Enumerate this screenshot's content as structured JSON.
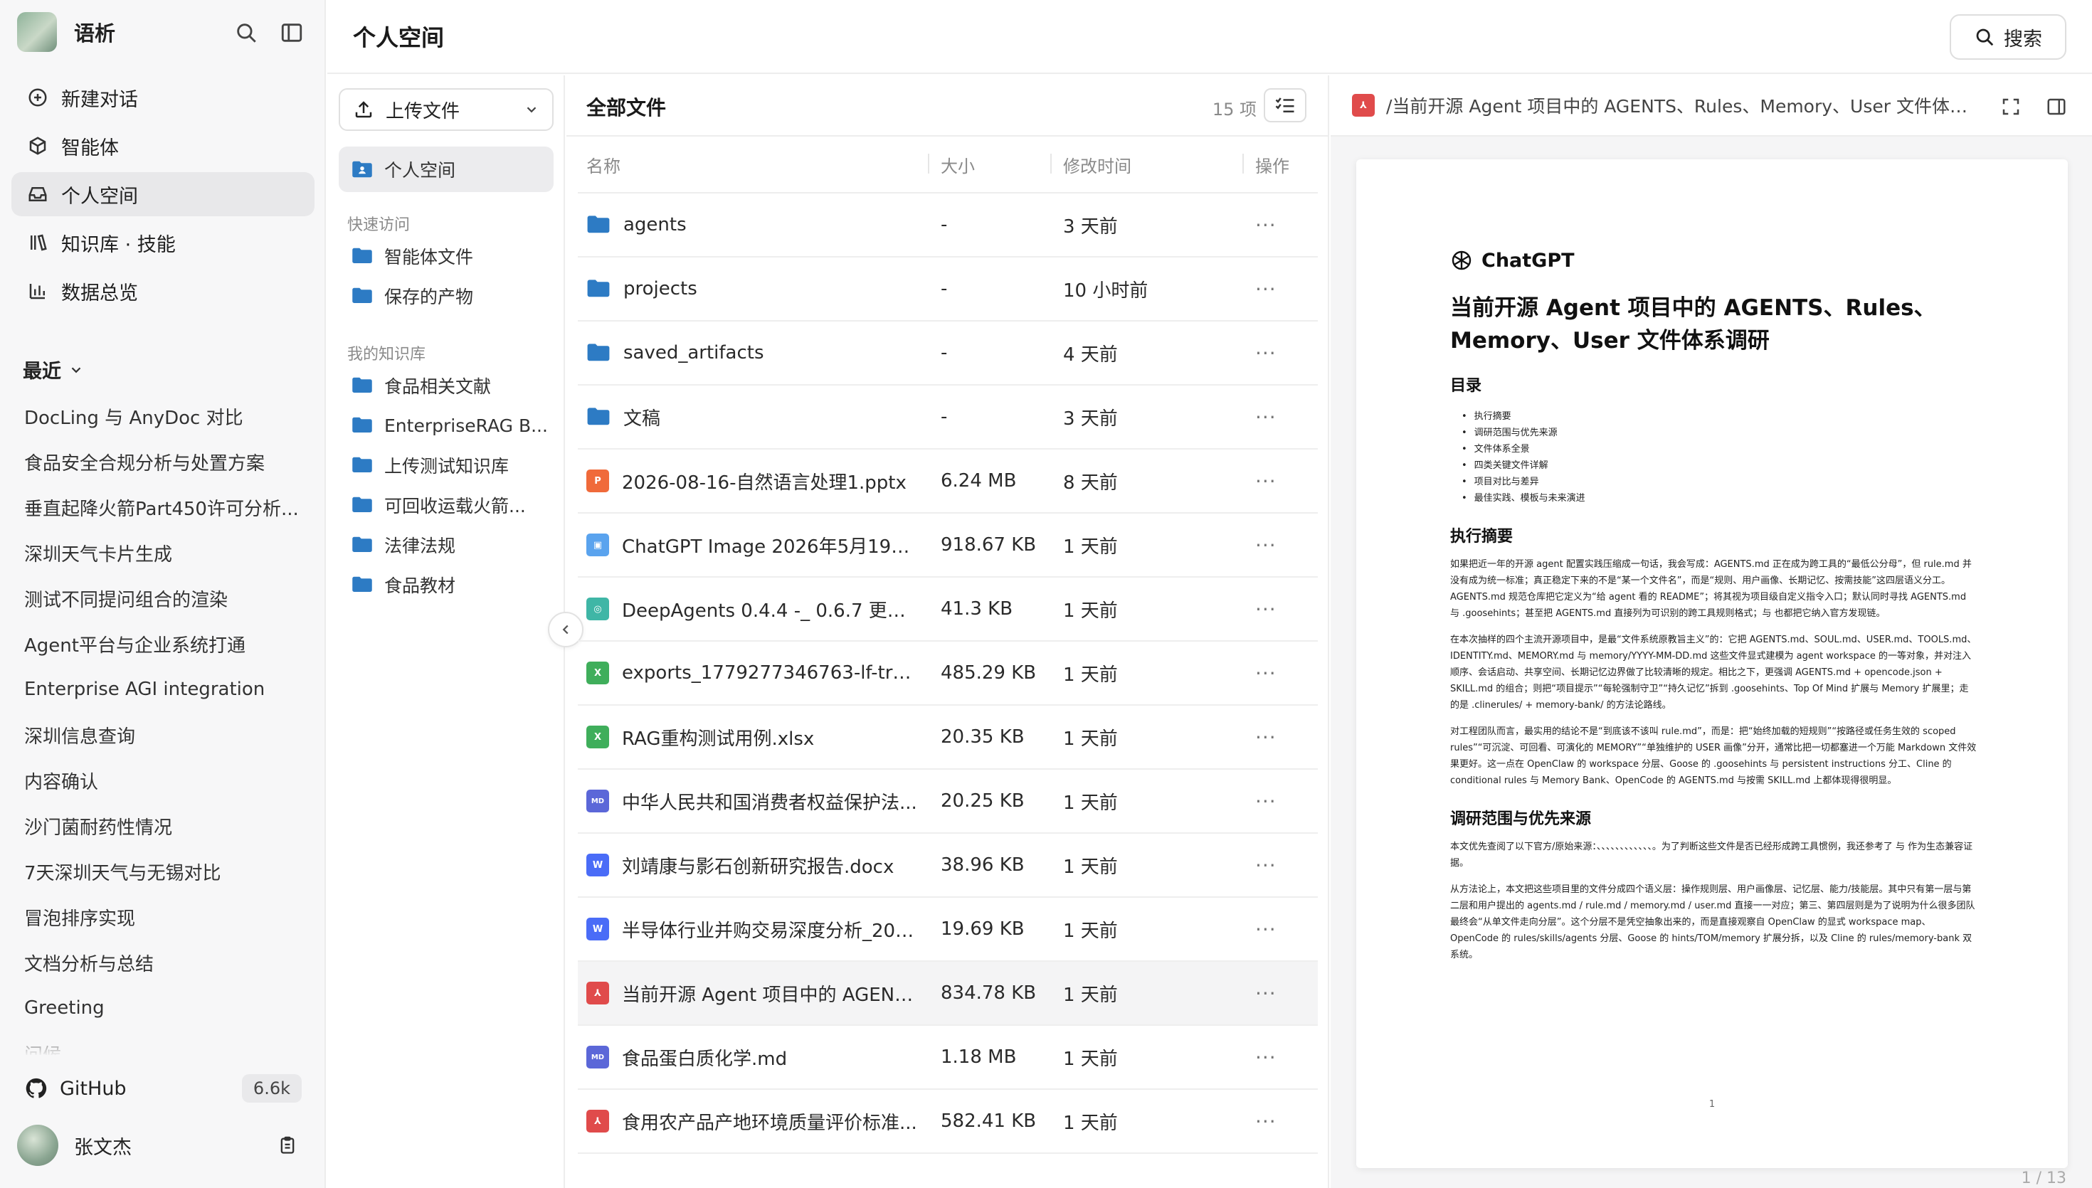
{
  "app": {
    "name": "语析",
    "page_title": "个人空间",
    "search_label": "搜索"
  },
  "sidebar": {
    "nav": [
      {
        "label": "新建对话",
        "icon": "plus-circle-icon"
      },
      {
        "label": "智能体",
        "icon": "cube-icon"
      },
      {
        "label": "个人空间",
        "icon": "inbox-icon",
        "active": true
      },
      {
        "label": "知识库 · 技能",
        "icon": "library-icon"
      },
      {
        "label": "数据总览",
        "icon": "bar-chart-icon"
      }
    ],
    "recent_label": "最近",
    "recent": [
      "DocLing 与 AnyDoc 对比",
      "食品安全合规分析与处置方案",
      "垂直起降火箭Part450许可分析...",
      "深圳天气卡片生成",
      "测试不同提问组合的渲染",
      "Agent平台与企业系统打通",
      "Enterprise AGI integration",
      "深圳信息查询",
      "内容确认",
      "沙门菌耐药性情况",
      "7天深圳天气与无锡对比",
      "冒泡排序实现",
      "文档分析与总结",
      "Greeting",
      "问候"
    ],
    "github_label": "GitHub",
    "github_stars": "6.6k",
    "user_name": "张文杰"
  },
  "folders": {
    "upload_label": "上传文件",
    "active_label": "个人空间",
    "quick_access_label": "快速访问",
    "quick_access": [
      "智能体文件",
      "保存的产物"
    ],
    "kb_label": "我的知识库",
    "knowledge_bases": [
      "食品相关文献",
      "EnterpriseRAG B...",
      "上传测试知识库",
      "可回收运载火箭...",
      "法律法规",
      "食品教材"
    ]
  },
  "files": {
    "title": "全部文件",
    "count": "15 项",
    "columns": {
      "name": "名称",
      "size": "大小",
      "time": "修改时间",
      "action": "操作"
    },
    "rows": [
      {
        "name": "agents",
        "size": "-",
        "time": "3 天前",
        "type": "folder"
      },
      {
        "name": "projects",
        "size": "-",
        "time": "10 小时前",
        "type": "folder"
      },
      {
        "name": "saved_artifacts",
        "size": "-",
        "time": "4 天前",
        "type": "folder"
      },
      {
        "name": "文稿",
        "size": "-",
        "time": "3 天前",
        "type": "folder"
      },
      {
        "name": "2026-08-16-自然语言处理1.pptx",
        "size": "6.24 MB",
        "time": "8 天前",
        "type": "pptx",
        "glyph": "P"
      },
      {
        "name": "ChatGPT Image 2026年5月19日 ...",
        "size": "918.67 KB",
        "time": "1 天前",
        "type": "image",
        "glyph": "▣"
      },
      {
        "name": "DeepAgents 0.4.4 -_ 0.6.7 更新...",
        "size": "41.3 KB",
        "time": "1 天前",
        "type": "web",
        "glyph": "◎"
      },
      {
        "name": "exports_1779277346763-lf-trac...",
        "size": "485.29 KB",
        "time": "1 天前",
        "type": "xlsx",
        "glyph": "X"
      },
      {
        "name": "RAG重构测试用例.xlsx",
        "size": "20.35 KB",
        "time": "1 天前",
        "type": "xlsx",
        "glyph": "X"
      },
      {
        "name": "中华人民共和国消费者权益保护法...",
        "size": "20.25 KB",
        "time": "1 天前",
        "type": "md",
        "glyph": "MD"
      },
      {
        "name": "刘靖康与影石创新研究报告.docx",
        "size": "38.96 KB",
        "time": "1 天前",
        "type": "docx",
        "glyph": "W"
      },
      {
        "name": "半导体行业并购交易深度分析_201...",
        "size": "19.69 KB",
        "time": "1 天前",
        "type": "docx",
        "glyph": "W"
      },
      {
        "name": "当前开源 Agent 项目中的 AGENT...",
        "size": "834.78 KB",
        "time": "1 天前",
        "type": "pdf",
        "glyph": "⅄",
        "selected": true
      },
      {
        "name": "食品蛋白质化学.md",
        "size": "1.18 MB",
        "time": "1 天前",
        "type": "md",
        "glyph": "MD"
      },
      {
        "name": "食用农产品产地环境质量评价标准...",
        "size": "582.41 KB",
        "time": "1 天前",
        "type": "pdf",
        "glyph": "⅄"
      }
    ],
    "row_action": "···"
  },
  "preview": {
    "file_name": "/当前开源 Agent 项目中的 AGENTS、Rules、Memory、User 文件体系调...",
    "doc_brand": "ChatGPT",
    "doc_title": "当前开源 Agent 项目中的 AGENTS、Rules、Memory、User 文件体系调研",
    "toc_heading": "目录",
    "toc": [
      "执行摘要",
      "调研范围与优先来源",
      "文件体系全景",
      "四类关键文件详解",
      "项目对比与差异",
      "最佳实践、模板与未来演进"
    ],
    "sec1_heading": "执行摘要",
    "sec1_p1": "如果把近一年的开源 agent 配置实践压缩成一句话，我会写成：AGENTS.md 正在成为跨工具的“最低公分母”，但 rule.md 并没有成为统一标准；真正稳定下来的不是“某一个文件名”，而是“规则、用户画像、长期记忆、按需技能”这四层语义分工。AGENTS.md 规范仓库把它定义为“给 agent 看的 README”；将其视为项目级自定义指令入口；默认同时寻找 AGENTS.md 与 .goosehints；甚至把 AGENTS.md 直接列为可识别的跨工具规则格式；与 也都把它纳入官方发现链。",
    "sec1_p2": "在本次抽样的四个主流开源项目中，是最“文件系统原教旨主义”的：它把 AGENTS.md、SOUL.md、USER.md、TOOLS.md、IDENTITY.md、MEMORY.md 与 memory/YYYY-MM-DD.md 这些文件显式建模为 agent workspace 的一等对象，并对注入顺序、会话启动、共享空间、长期记忆边界做了比较清晰的规定。相比之下，更强调 AGENTS.md + opencode.json + SKILL.md 的组合；则把“项目提示”“每轮强制守卫”“持久记忆”拆到 .goosehints、Top Of Mind 扩展与 Memory 扩展里；走的是 .clinerules/ + memory-bank/ 的方法论路线。",
    "sec1_p3": "对工程团队而言，最实用的结论不是“到底该不该叫 rule.md”，而是：把“始终加载的短规则”“按路径或任务生效的 scoped rules”“可沉淀、可回看、可演化的 MEMORY”“单独维护的 USER 画像”分开，通常比把一切都塞进一个万能 Markdown 文件效果更好。这一点在 OpenClaw 的 workspace 分层、Goose 的 .goosehints 与 persistent instructions 分工、Cline 的 conditional rules 与 Memory Bank、OpenCode 的 AGENTS.md 与按需 SKILL.md 上都体现得很明显。",
    "sec2_heading": "调研范围与优先来源",
    "sec2_p1": "本文优先查阅了以下官方/原始来源：、、、、、、、、、、、、。为了判断这些文件是否已经形成跨工具惯例，我还参考了 与 作为生态兼容证据。",
    "sec2_p2": "从方法论上，本文把这些项目里的文件分成四个语义层：操作规则层、用户画像层、记忆层、能力/技能层。其中只有第一层与第二层和用户提出的 agents.md / rule.md / memory.md / user.md 直接一一对应；第三、第四层则是为了说明为什么很多团队最终会“从单文件走向分层”。这个分层不是凭空抽象出来的，而是直接观察自 OpenClaw 的显式 workspace map、OpenCode 的 rules/skills/agents 分层、Goose 的 hints/TOM/memory 扩展分拆，以及 Cline 的 rules/memory-bank 双系统。",
    "page_number": "1",
    "page_indicator": "1 / 13"
  },
  "colors": {
    "folder": "#2d7bc4",
    "pdf": "#e04b4b",
    "xlsx": "#3fae5b",
    "docx": "#4a6cf7",
    "md": "#5b67d8",
    "pptx": "#f06a3a",
    "image": "#5aa3ee",
    "web": "#3fb6a6"
  }
}
